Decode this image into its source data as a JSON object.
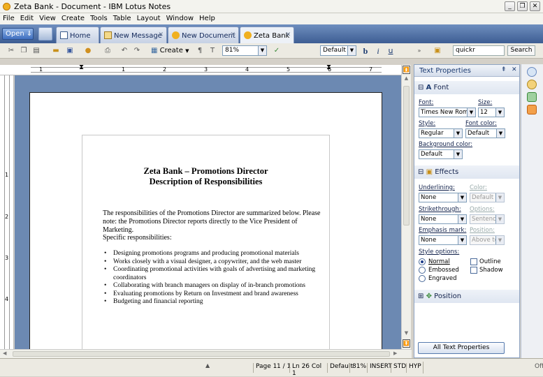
{
  "window": {
    "title": "Zeta Bank - Document - IBM Lotus Notes",
    "min": "_",
    "restore": "❐",
    "close": "✕"
  },
  "menu": [
    "File",
    "Edit",
    "View",
    "Create",
    "Tools",
    "Table",
    "Layout",
    "Window",
    "Help"
  ],
  "tabbar": {
    "open_label": "Open",
    "tabs": [
      {
        "label": "Home",
        "icon": "home-icon"
      },
      {
        "label": "New Message",
        "icon": "mail-icon"
      },
      {
        "label": "New Document",
        "icon": "document-icon"
      },
      {
        "label": "Zeta Bank",
        "icon": "document-icon",
        "active": true
      }
    ],
    "close_glyph": "✕"
  },
  "toolbar": {
    "create_label": "Create",
    "zoom_value": "81%",
    "font_value": "Default T",
    "search_value": "quickr",
    "search_button": "Search",
    "bold": "b",
    "italic": "i",
    "underline": "u"
  },
  "ruler": {
    "marks": [
      "1",
      "1",
      "2",
      "3",
      "4",
      "5",
      "6",
      "7"
    ]
  },
  "left_ruler": {
    "marks": [
      "1",
      "2",
      "3",
      "4"
    ]
  },
  "document": {
    "title_line1": "Zeta Bank – Promotions Director",
    "title_line2": "Description of Responsibilities",
    "intro": "The responsibilities of the Promotions Director are summarized below.  Please note: the Promotions Director reports directly to the Vice President of Marketing.",
    "specific": "Specific responsibilities:",
    "items": [
      "Designing promotions programs and producing promotional materials",
      "Works closely with a visual designer, a copywriter, and the web master",
      "Coordinating promotional activities with goals of advertising and marketing coordinators",
      "Collaborating with branch managers on display of in-branch promotions",
      "Evaluating promotions by Return on Investment and brand awareness",
      "Budgeting and financial reporting"
    ]
  },
  "text_properties": {
    "header": "Text Properties",
    "font_section": "Font",
    "font_label": "Font:",
    "font_value": "Times New Roman",
    "size_label": "Size:",
    "size_value": "12",
    "style_label": "Style:",
    "style_value": "Regular",
    "font_color_label": "Font color:",
    "font_color_value": "Default",
    "bg_color_label": "Background color:",
    "bg_color_value": "Default",
    "effects_section": "Effects",
    "underlining_label": "Underlining:",
    "underlining_value": "None",
    "color_label": "Color:",
    "color_value": "Default",
    "strikethrough_label": "Strikethrough:",
    "strikethrough_value": "None",
    "options_label": "Options:",
    "options_value": "Sentence",
    "emphasis_label": "Emphasis mark:",
    "emphasis_value": "None",
    "position_label": "Position:",
    "position_value": "Above te",
    "style_options_label": "Style options:",
    "radio_normal": "Normal",
    "radio_embossed": "Embossed",
    "radio_engraved": "Engraved",
    "chk_outline": "Outline",
    "chk_shadow": "Shadow",
    "position_section": "Position",
    "all_button": "All Text Properties"
  },
  "status": {
    "page": "Page 1",
    "of": "1 / 1",
    "line": "Ln 26 Col 1",
    "style": "Default",
    "zoom": "81%",
    "insert": "INSERT",
    "std": "STD",
    "hyp": "HYP",
    "off": "Off"
  },
  "colors": {
    "tabbar": "#3d5d93",
    "doc_bg": "#6c89b2",
    "accent": "#1b3a70"
  }
}
